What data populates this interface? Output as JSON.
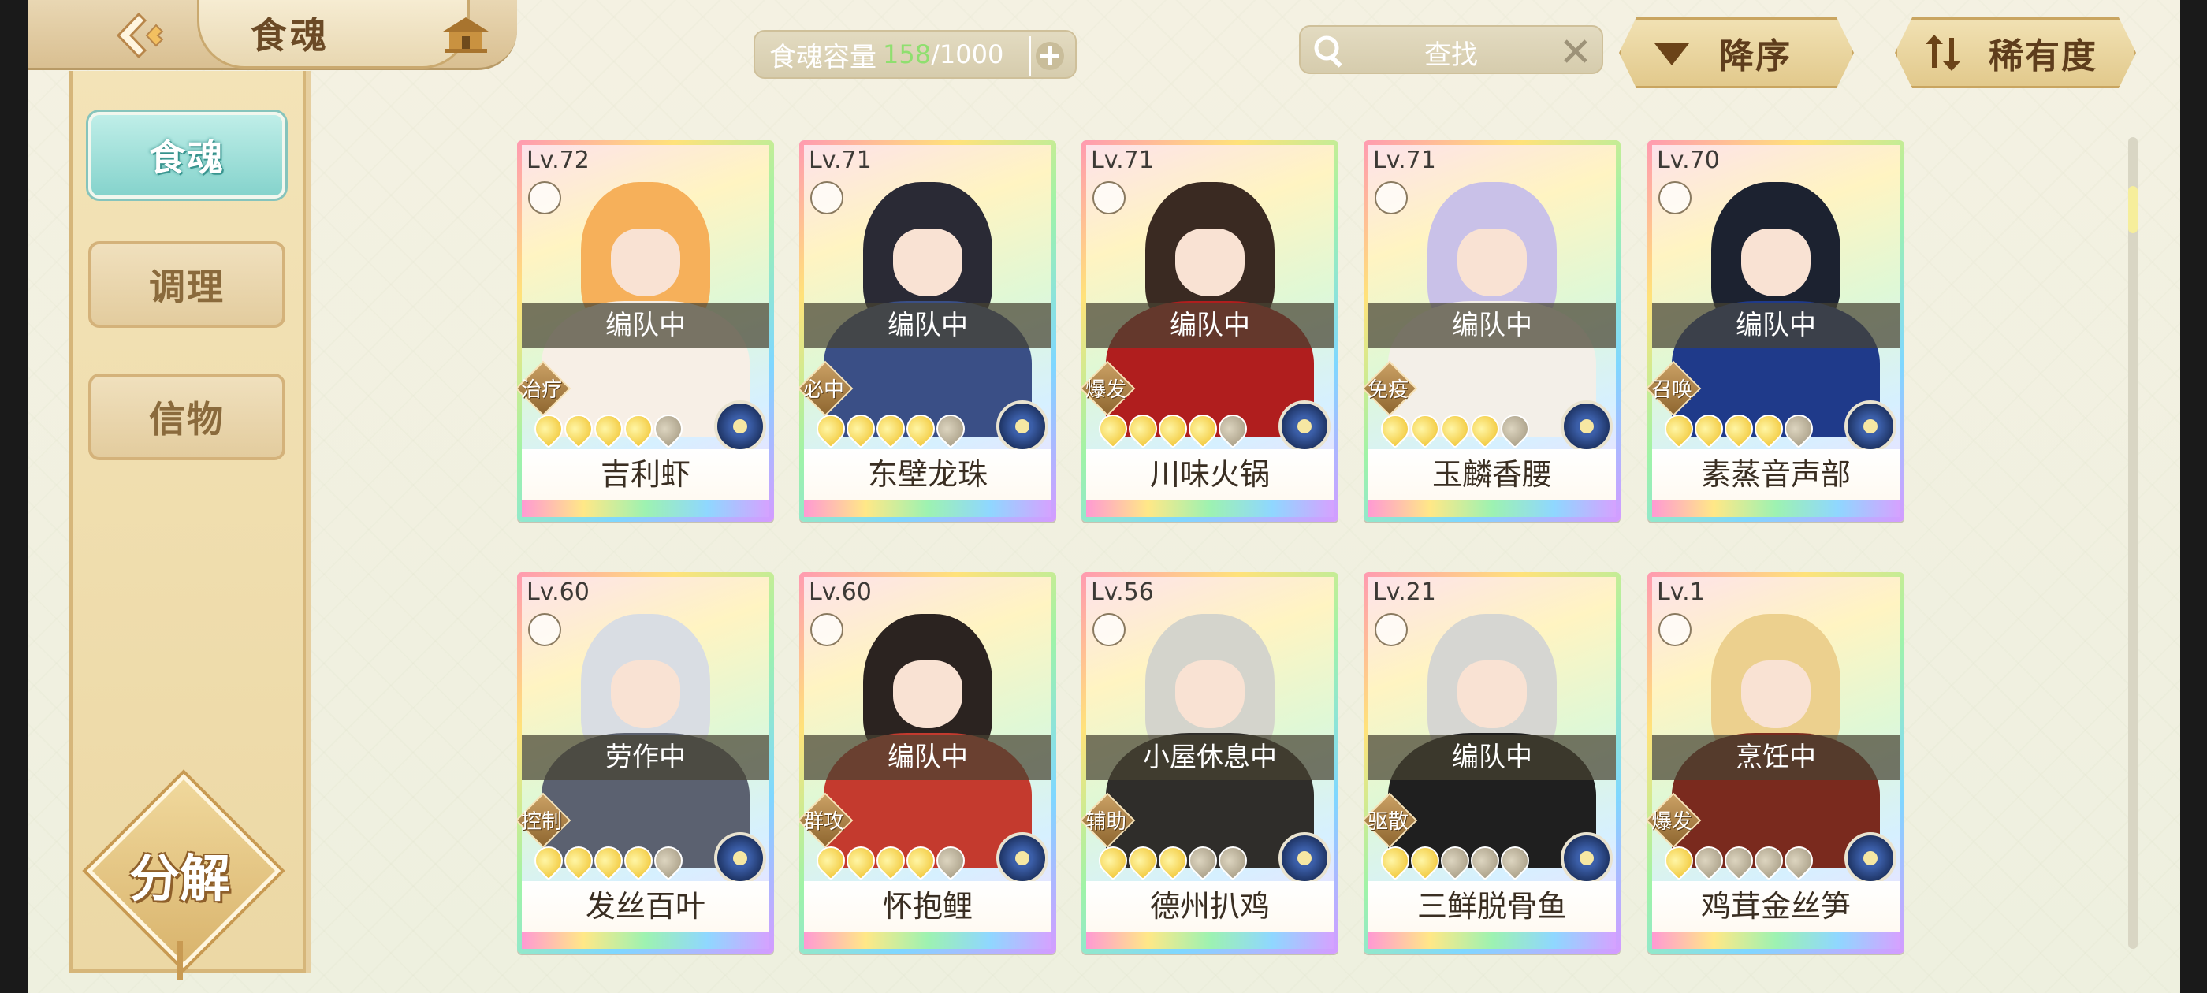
{
  "header": {
    "title": "食魂",
    "capacity": {
      "label": "食魂容量",
      "current": "158",
      "separator": "/",
      "max": "1000"
    },
    "search": {
      "label": "查找"
    },
    "sort_order": {
      "label": "降序"
    },
    "sort_key": {
      "label": "稀有度"
    }
  },
  "sidebar": {
    "items": [
      {
        "label": "食魂",
        "active": true
      },
      {
        "label": "调理",
        "active": false
      },
      {
        "label": "信物",
        "active": false
      }
    ],
    "decompose_label": "分解"
  },
  "cards": [
    {
      "level": "Lv.72",
      "status": "编队中",
      "role": "治疗",
      "stars": 4,
      "name": "吉利虾",
      "hair": "#f6b05a",
      "robe": "#f7efe6"
    },
    {
      "level": "Lv.71",
      "status": "编队中",
      "role": "必中",
      "stars": 4,
      "name": "东壁龙珠",
      "hair": "#2a2a35",
      "robe": "#3a4f86"
    },
    {
      "level": "Lv.71",
      "status": "编队中",
      "role": "爆发",
      "stars": 4,
      "name": "川味火锅",
      "hair": "#3a2a22",
      "robe": "#b01e1e"
    },
    {
      "level": "Lv.71",
      "status": "编队中",
      "role": "免疫",
      "stars": 4,
      "name": "玉麟香腰",
      "hair": "#c9c1e8",
      "robe": "#f3efe8"
    },
    {
      "level": "Lv.70",
      "status": "编队中",
      "role": "召唤",
      "stars": 4,
      "name": "素蒸音声部",
      "hair": "#1c2230",
      "robe": "#1f3a8a"
    },
    {
      "level": "Lv.60",
      "status": "劳作中",
      "role": "控制",
      "stars": 4,
      "name": "发丝百叶",
      "hair": "#d9dde3",
      "robe": "#5b6170"
    },
    {
      "level": "Lv.60",
      "status": "编队中",
      "role": "群攻",
      "stars": 4,
      "name": "怀抱鲤",
      "hair": "#2b2320",
      "robe": "#c43a2e"
    },
    {
      "level": "Lv.56",
      "status": "小屋休息中",
      "role": "辅助",
      "stars": 3,
      "name": "德州扒鸡",
      "hair": "#d4d4cc",
      "robe": "#2f2d2a"
    },
    {
      "level": "Lv.21",
      "status": "编队中",
      "role": "驱散",
      "stars": 2,
      "name": "三鲜脱骨鱼",
      "hair": "#d6d6d2",
      "robe": "#1f1f1f"
    },
    {
      "level": "Lv.1",
      "status": "烹饪中",
      "role": "爆发",
      "stars": 1,
      "name": "鸡茸金丝笋",
      "hair": "#ecd08e",
      "robe": "#7a2a1e"
    }
  ],
  "colors": {
    "accent_teal": "#85d3cc",
    "gold": "#d9b46d",
    "capacity_green": "#8fdf6f"
  },
  "icons": [
    "back-icon",
    "home-icon",
    "plus-icon",
    "search-icon",
    "clear-icon",
    "descend-icon",
    "sort-icon",
    "element-icon",
    "condition-icon"
  ]
}
